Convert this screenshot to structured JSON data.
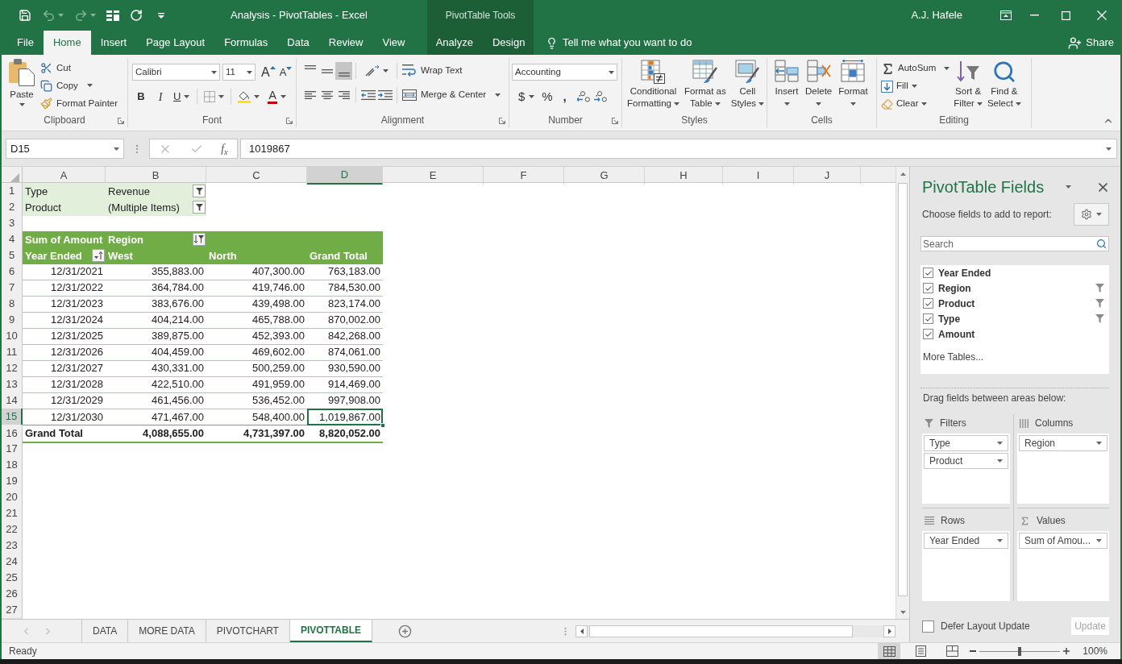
{
  "window": {
    "title": "Analysis - PivotTables - Excel",
    "context_group": "PivotTable Tools",
    "user": "A.J. Hafele"
  },
  "quick_access": [
    {
      "kind": "save",
      "disabled": false
    },
    {
      "kind": "undo",
      "disabled": true
    },
    {
      "kind": "redo",
      "disabled": true
    },
    {
      "kind": "form",
      "disabled": false
    },
    {
      "kind": "refresh",
      "disabled": false
    },
    {
      "kind": "customize",
      "disabled": false
    }
  ],
  "ribbon_tabs": [
    {
      "label": "File",
      "selected": false,
      "contextual": false
    },
    {
      "label": "Home",
      "selected": true,
      "contextual": false
    },
    {
      "label": "Insert",
      "selected": false,
      "contextual": false
    },
    {
      "label": "Page Layout",
      "selected": false,
      "contextual": false
    },
    {
      "label": "Formulas",
      "selected": false,
      "contextual": false
    },
    {
      "label": "Data",
      "selected": false,
      "contextual": false
    },
    {
      "label": "Review",
      "selected": false,
      "contextual": false
    },
    {
      "label": "View",
      "selected": false,
      "contextual": false
    },
    {
      "label": "Analyze",
      "selected": false,
      "contextual": true
    },
    {
      "label": "Design",
      "selected": false,
      "contextual": true
    }
  ],
  "tell_me": "Tell me what you want to do",
  "share": "Share",
  "ribbon": {
    "clipboard": {
      "label": "Clipboard",
      "paste": "Paste",
      "cut": "Cut",
      "copy": "Copy",
      "format_painter": "Format Painter"
    },
    "font": {
      "label": "Font",
      "name": "Calibri",
      "size": "11",
      "grow": "A",
      "shrink": "A",
      "bold": "B",
      "italic": "I",
      "underline": "U",
      "font_color": "A"
    },
    "alignment": {
      "label": "Alignment",
      "vertical": [
        {
          "kind": "top",
          "selected": false
        },
        {
          "kind": "middle",
          "selected": false
        },
        {
          "kind": "bottom",
          "selected": true
        }
      ],
      "horizontal": [
        {
          "kind": "left",
          "selected": false
        },
        {
          "kind": "center",
          "selected": false
        },
        {
          "kind": "right",
          "selected": false
        }
      ],
      "wrap_text": "Wrap Text",
      "merge_center": "Merge & Center"
    },
    "number": {
      "label": "Number",
      "format": "Accounting",
      "currency": "$",
      "percent": "%",
      "comma": ","
    },
    "styles": {
      "label": "Styles",
      "buttons": [
        {
          "kind": "conditional",
          "lines": [
            "Conditional",
            "Formatting"
          ]
        },
        {
          "kind": "table",
          "lines": [
            "Format as",
            "Table"
          ]
        },
        {
          "kind": "cell_styles",
          "lines": [
            "Cell",
            "Styles"
          ]
        }
      ]
    },
    "cells": {
      "label": "Cells",
      "buttons": [
        {
          "kind": "insert",
          "label": "Insert"
        },
        {
          "kind": "delete",
          "label": "Delete"
        },
        {
          "kind": "format",
          "label": "Format"
        }
      ]
    },
    "editing": {
      "label": "Editing",
      "autosum": "AutoSum",
      "fill": "Fill",
      "clear": "Clear",
      "sort_filter": [
        "Sort &",
        "Filter"
      ],
      "find_select": [
        "Find &",
        "Select"
      ]
    }
  },
  "formula_bar": {
    "name_box": "D15",
    "function_label": "f$_{x}$",
    "formula": "1019867"
  },
  "sheet": {
    "columns": [
      {
        "label": "A",
        "selected": false
      },
      {
        "label": "B",
        "selected": false
      },
      {
        "label": "C",
        "selected": false
      },
      {
        "label": "D",
        "selected": true
      },
      {
        "label": "E",
        "selected": false
      },
      {
        "label": "F",
        "selected": false
      },
      {
        "label": "G",
        "selected": false
      },
      {
        "label": "H",
        "selected": false
      },
      {
        "label": "I",
        "selected": false
      },
      {
        "label": "J",
        "selected": false
      }
    ],
    "rows": [
      {
        "label": "1",
        "selected": false
      },
      {
        "label": "2",
        "selected": false
      },
      {
        "label": "3",
        "selected": false
      },
      {
        "label": "4",
        "selected": false
      },
      {
        "label": "5",
        "selected": false
      },
      {
        "label": "6",
        "selected": false
      },
      {
        "label": "7",
        "selected": false
      },
      {
        "label": "8",
        "selected": false
      },
      {
        "label": "9",
        "selected": false
      },
      {
        "label": "10",
        "selected": false
      },
      {
        "label": "11",
        "selected": false
      },
      {
        "label": "12",
        "selected": false
      },
      {
        "label": "13",
        "selected": false
      },
      {
        "label": "14",
        "selected": false
      },
      {
        "label": "15",
        "selected": true
      },
      {
        "label": "16",
        "selected": false
      },
      {
        "label": "17",
        "selected": false
      },
      {
        "label": "18",
        "selected": false
      },
      {
        "label": "19",
        "selected": false
      },
      {
        "label": "20",
        "selected": false
      },
      {
        "label": "21",
        "selected": false
      },
      {
        "label": "22",
        "selected": false
      },
      {
        "label": "23",
        "selected": false
      },
      {
        "label": "24",
        "selected": false
      },
      {
        "label": "25",
        "selected": false
      },
      {
        "label": "26",
        "selected": false
      },
      {
        "label": "27",
        "selected": false
      }
    ]
  },
  "pivot": {
    "filters": [
      {
        "field": "Type",
        "value": "Revenue"
      },
      {
        "field": "Product",
        "value": "(Multiple Items)"
      }
    ],
    "data_label": "Sum of Amount",
    "column_field": "Region",
    "row_field": "Year Ended",
    "column_items": [
      "West",
      "North",
      "Grand Total"
    ],
    "rows": [
      {
        "label": "12/31/2021",
        "values": [
          "355,883.00",
          "407,300.00",
          "763,183.00"
        ]
      },
      {
        "label": "12/31/2022",
        "values": [
          "364,784.00",
          "419,746.00",
          "784,530.00"
        ]
      },
      {
        "label": "12/31/2023",
        "values": [
          "383,676.00",
          "439,498.00",
          "823,174.00"
        ]
      },
      {
        "label": "12/31/2024",
        "values": [
          "404,214.00",
          "465,788.00",
          "870,002.00"
        ]
      },
      {
        "label": "12/31/2025",
        "values": [
          "389,875.00",
          "452,393.00",
          "842,268.00"
        ]
      },
      {
        "label": "12/31/2026",
        "values": [
          "404,459.00",
          "469,602.00",
          "874,061.00"
        ]
      },
      {
        "label": "12/31/2027",
        "values": [
          "430,331.00",
          "500,259.00",
          "930,590.00"
        ]
      },
      {
        "label": "12/31/2028",
        "values": [
          "422,510.00",
          "491,959.00",
          "914,469.00"
        ]
      },
      {
        "label": "12/31/2029",
        "values": [
          "461,456.00",
          "536,452.00",
          "997,908.00"
        ]
      },
      {
        "label": "12/31/2030",
        "values": [
          "471,467.00",
          "548,400.00",
          "1,019,867.00"
        ]
      }
    ],
    "total": {
      "label": "Grand Total",
      "values": [
        "4,088,655.00",
        "4,731,397.00",
        "8,820,052.00"
      ]
    }
  },
  "sheet_nav": [
    {
      "kind": "previous",
      "disabled": true
    },
    {
      "kind": "next",
      "disabled": true
    }
  ],
  "sheet_tabs": [
    {
      "label": "DATA",
      "selected": false
    },
    {
      "label": "MORE DATA",
      "selected": false
    },
    {
      "label": "PIVOTCHART",
      "selected": false
    },
    {
      "label": "PIVOTTABLE",
      "selected": true
    }
  ],
  "pivot_pane": {
    "title": "PivotTable Fields",
    "subtitle": "Choose fields to add to report:",
    "search": {
      "placeholder": "Search"
    },
    "fields": [
      {
        "name": "Year Ended",
        "checked": true,
        "filtered": false
      },
      {
        "name": "Region",
        "checked": true,
        "filtered": true
      },
      {
        "name": "Product",
        "checked": true,
        "filtered": true
      },
      {
        "name": "Type",
        "checked": true,
        "filtered": true
      },
      {
        "name": "Amount",
        "checked": true,
        "filtered": false
      }
    ],
    "more_tables": "More Tables...",
    "drag_hint": "Drag fields between areas below:",
    "areas": [
      {
        "kind": "filters",
        "label": "Filters",
        "items": [
          "Type",
          "Product"
        ]
      },
      {
        "kind": "columns",
        "label": "Columns",
        "items": [
          "Region"
        ]
      },
      {
        "kind": "rows",
        "label": "Rows",
        "items": [
          "Year Ended"
        ]
      },
      {
        "kind": "values",
        "label": "Values",
        "items": [
          "Sum of Amou..."
        ]
      }
    ],
    "defer": {
      "label": "Defer Layout Update",
      "checked": false
    },
    "update_button": {
      "label": "Update",
      "disabled": true
    }
  },
  "status_bar": {
    "text": "Ready",
    "views": [
      {
        "kind": "normal",
        "selected": true
      },
      {
        "kind": "page_layout",
        "selected": false
      },
      {
        "kind": "page_break",
        "selected": false
      }
    ],
    "zoom": {
      "level": 0.5,
      "reading": "100%"
    }
  }
}
